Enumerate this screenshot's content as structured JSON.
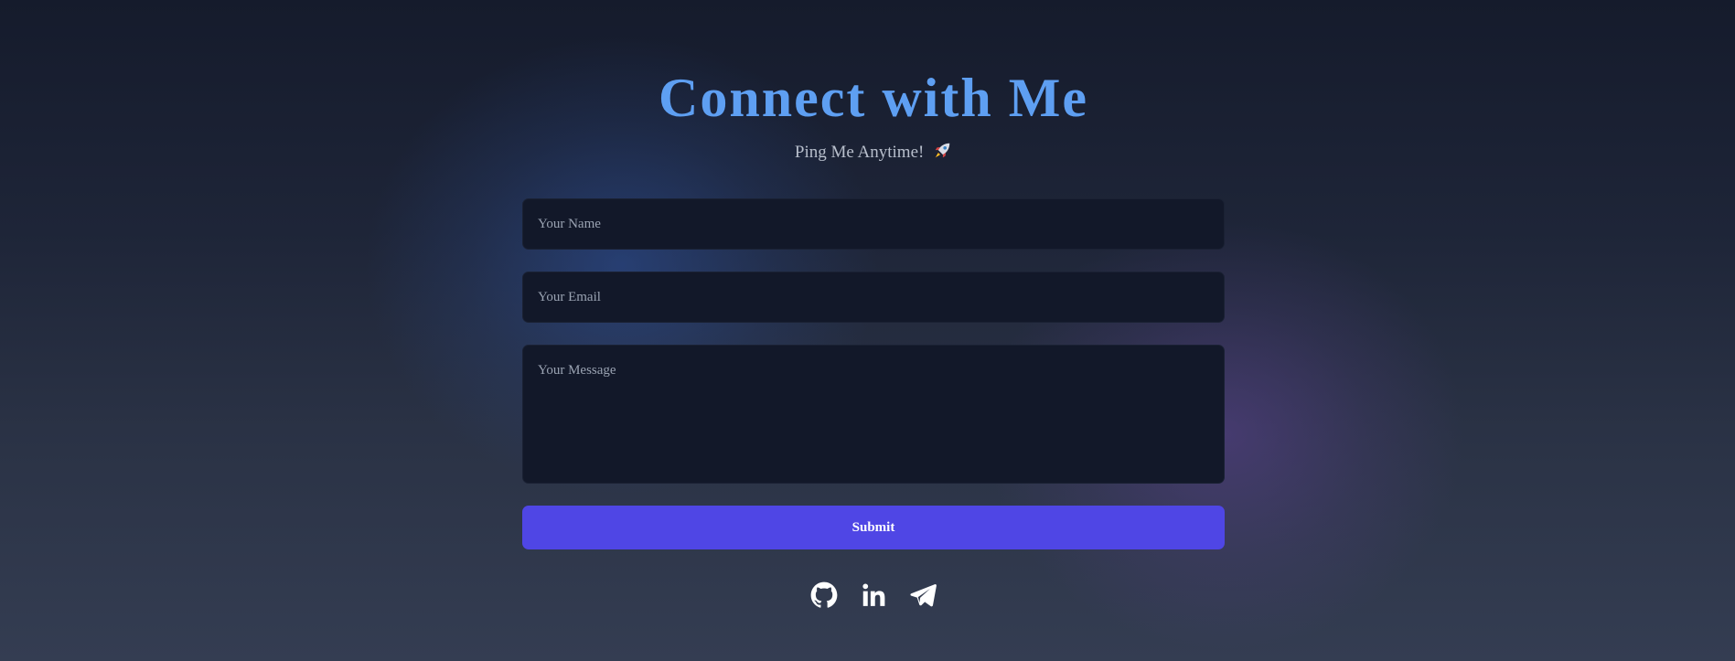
{
  "header": {
    "title": "Connect with Me",
    "subtitle": "Ping Me Anytime!",
    "subtitle_emoji": "rocket-icon"
  },
  "form": {
    "name_placeholder": "Your Name",
    "email_placeholder": "Your Email",
    "message_placeholder": "Your Message",
    "submit_label": "Submit"
  },
  "socials": [
    {
      "icon": "github-icon"
    },
    {
      "icon": "linkedin-icon"
    },
    {
      "icon": "telegram-icon"
    }
  ],
  "colors": {
    "title": "#5e9ff2",
    "submit_button": "#4f46e5",
    "field_background": "#121829",
    "page_background_top": "#151b2c",
    "page_background_bottom": "#343d52"
  }
}
